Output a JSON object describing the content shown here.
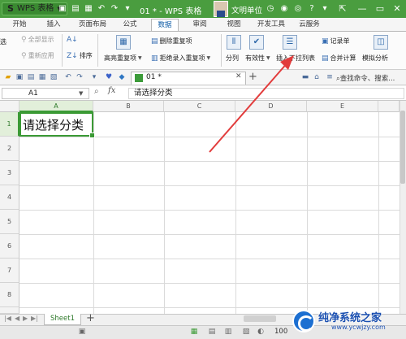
{
  "titlebar": {
    "app_label": "WPS 表格",
    "doc_title": "01 * - WPS 表格",
    "user_name": "文明单位",
    "bg_color": "#4a9d3f"
  },
  "menu": {
    "tabs": [
      "开始",
      "插入",
      "页面布局",
      "公式",
      "数据",
      "审阅",
      "视图",
      "开发工具",
      "云服务"
    ],
    "active_tab": "数据"
  },
  "ribbon": {
    "show_all": "全部显示",
    "reapply": "重新应用",
    "filter_partial": "选",
    "sort": "排序",
    "highlight_dup": "高亮重复项",
    "delete_dup": "删除重复项",
    "reject_dup": "拒绝录入重复项",
    "split": "分列",
    "validity": "有效性",
    "insert_dropdown": "插入下拉列表",
    "record": "记录单",
    "consolidate": "合并计算",
    "simulation": "模拟分析"
  },
  "quickbar": {
    "doc_tab": "01 *",
    "find_placeholder": "查找命令、搜索..."
  },
  "formula_bar": {
    "cell_ref": "A1",
    "fx": "fx",
    "content": "请选择分类"
  },
  "grid": {
    "columns": [
      "A",
      "B",
      "C",
      "D",
      "E"
    ],
    "rows": [
      "1",
      "2",
      "3",
      "4",
      "5",
      "6",
      "7",
      "8"
    ],
    "cell_a1": "请选择分类"
  },
  "sheets": {
    "tabs": [
      "Sheet1"
    ]
  },
  "status": {
    "zoom": "100"
  },
  "watermark": {
    "title": "纯净系统之家",
    "url": "www.ycwjzy.com"
  },
  "colors": {
    "accent_green": "#3b9a35",
    "arrow_red": "#e23c3c"
  }
}
